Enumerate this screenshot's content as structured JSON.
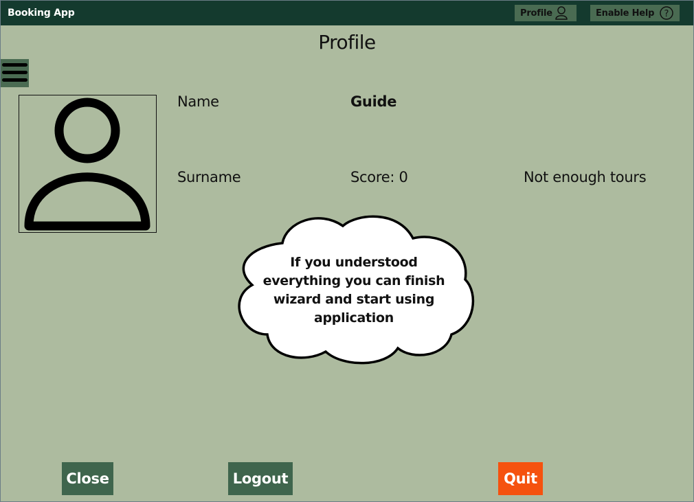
{
  "titlebar": {
    "app_title": "Booking App",
    "profile_label": "Profile",
    "profile_icon": "user-icon",
    "help_label": "Enable Help",
    "help_icon": "question-icon"
  },
  "page": {
    "title": "Profile",
    "menu_icon": "hamburger-menu-icon",
    "avatar_icon": "user-avatar-icon"
  },
  "profile": {
    "name_label": "Name",
    "name_value": "Guide",
    "surname_label": "Surname",
    "score": "Score: 0",
    "tours_status": "Not enough tours"
  },
  "help_cloud": {
    "message": "If you understood everything you can finish wizard and start using application"
  },
  "buttons": {
    "close": "Close",
    "logout": "Logout",
    "quit": "Quit"
  },
  "colors": {
    "background": "#adbb9f",
    "titlebar": "#143a2e",
    "button_green": "#3f654d",
    "quit_orange": "#f5520f"
  }
}
